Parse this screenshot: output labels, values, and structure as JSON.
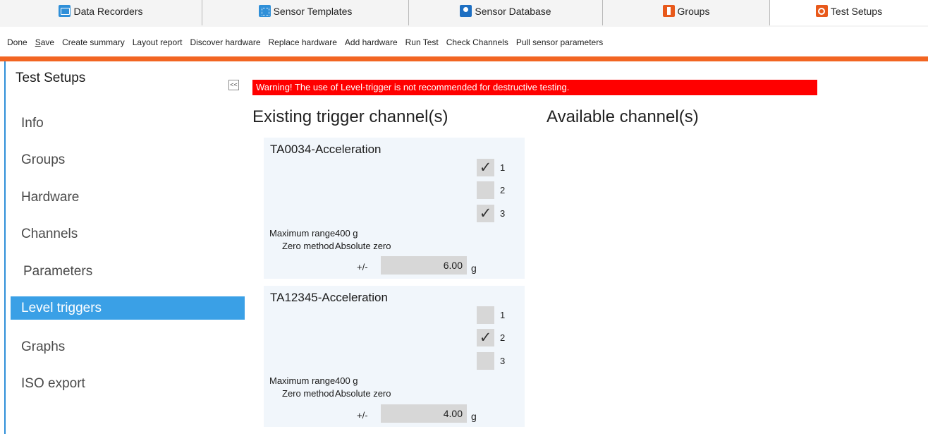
{
  "tabs": [
    {
      "label": "Data Recorders",
      "icon": "data-recorders-icon",
      "active": false
    },
    {
      "label": "Sensor Templates",
      "icon": "sensor-templates-icon",
      "active": false
    },
    {
      "label": "Sensor Database",
      "icon": "sensor-database-icon",
      "active": false
    },
    {
      "label": "Groups",
      "icon": "groups-icon",
      "active": false
    },
    {
      "label": "Test Setups",
      "icon": "test-setups-icon",
      "active": true
    }
  ],
  "toolbar": {
    "done": "Done",
    "save_first": "S",
    "save_rest": "ave",
    "create_summary": "Create summary",
    "layout_report": "Layout report",
    "discover_hardware": "Discover hardware",
    "replace_hardware": "Replace hardware",
    "add_hardware": "Add hardware",
    "run_test": "Run Test",
    "check_channels": "Check Channels",
    "pull_sensor_parameters": "Pull sensor parameters"
  },
  "colors": {
    "accent": "#f26522",
    "selection": "#3aa0e6",
    "warning": "#ff0000"
  },
  "sidebar": {
    "title": "Test Setups",
    "collapse_label": "<<",
    "items": [
      {
        "label": "Info",
        "active": false
      },
      {
        "label": "Groups",
        "active": false
      },
      {
        "label": "Hardware",
        "active": false
      },
      {
        "label": "Channels",
        "active": false
      },
      {
        "label": "Parameters",
        "active": false
      },
      {
        "label": "Level triggers",
        "active": true
      },
      {
        "label": "Graphs",
        "active": false
      },
      {
        "label": "ISO export",
        "active": false
      }
    ]
  },
  "main": {
    "warning": "Warning! The use of Level-trigger is not recommended for destructive testing.",
    "existing_heading": "Existing trigger channel(s)",
    "available_heading": "Available channel(s)",
    "cards": [
      {
        "title": "TA0034-Acceleration",
        "checkmark": "✓",
        "channels": [
          {
            "number": "1",
            "checked": true
          },
          {
            "number": "2",
            "checked": false
          },
          {
            "number": "3",
            "checked": true
          }
        ],
        "max_range_label": "Maximum range",
        "max_range_value": "400 g",
        "zero_method_label": "Zero method",
        "zero_method_value": "Absolute zero",
        "plus_minus": "+/-",
        "threshold": "6.00",
        "unit": "g"
      },
      {
        "title": "TA12345-Acceleration",
        "checkmark": "✓",
        "channels": [
          {
            "number": "1",
            "checked": false
          },
          {
            "number": "2",
            "checked": true
          },
          {
            "number": "3",
            "checked": false
          }
        ],
        "max_range_label": "Maximum range",
        "max_range_value": "400 g",
        "zero_method_label": "Zero method",
        "zero_method_value": "Absolute zero",
        "plus_minus": "+/-",
        "threshold": "4.00",
        "unit": "g"
      }
    ]
  }
}
